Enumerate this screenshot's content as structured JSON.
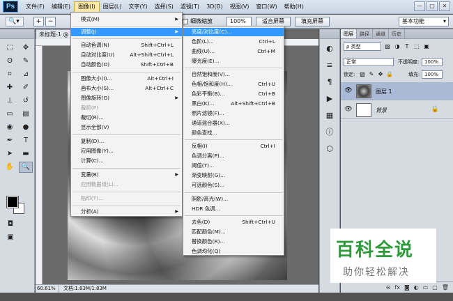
{
  "app": {
    "logo": "Ps"
  },
  "menubar": {
    "items": [
      "文件(F)",
      "编辑(E)",
      "图像(I)",
      "图层(L)",
      "文字(Y)",
      "选择(S)",
      "滤镜(T)",
      "3D(D)",
      "视图(V)",
      "窗口(W)",
      "帮助(H)"
    ],
    "active_index": 2,
    "window_controls": [
      "—",
      "□",
      "✕"
    ]
  },
  "options_bar": {
    "scrubby_zoom": "细微缩放",
    "zoom_value": "100%",
    "fit_screen": "适合屏幕",
    "fill_screen": "填充屏幕",
    "workspace": "基本功能"
  },
  "document": {
    "tab_title": "未标题-1 @",
    "zoom": "60.61%",
    "doc_info": "文档:1.83M/1.83M"
  },
  "image_menu": {
    "items": [
      {
        "label": "模式(M)",
        "shortcut": "",
        "submenu": true,
        "disabled": false
      },
      {
        "label": "调整(J)",
        "shortcut": "",
        "submenu": true,
        "disabled": false,
        "highlighted": true
      },
      {
        "label": "自动色调(N)",
        "shortcut": "Shift+Ctrl+L",
        "disabled": false
      },
      {
        "label": "自动对比度(U)",
        "shortcut": "Alt+Shift+Ctrl+L",
        "disabled": false
      },
      {
        "label": "自动颜色(O)",
        "shortcut": "Shift+Ctrl+B",
        "disabled": false
      },
      {
        "label": "图像大小(I)...",
        "shortcut": "Alt+Ctrl+I",
        "disabled": false
      },
      {
        "label": "画布大小(S)...",
        "shortcut": "Alt+Ctrl+C",
        "disabled": false
      },
      {
        "label": "图像旋转(G)",
        "shortcut": "",
        "submenu": true,
        "disabled": false
      },
      {
        "label": "裁剪(P)",
        "shortcut": "",
        "disabled": true
      },
      {
        "label": "裁切(R)...",
        "shortcut": "",
        "disabled": false
      },
      {
        "label": "显示全部(V)",
        "shortcut": "",
        "disabled": false
      },
      {
        "label": "复制(D)...",
        "shortcut": "",
        "disabled": false
      },
      {
        "label": "应用图像(Y)...",
        "shortcut": "",
        "disabled": false
      },
      {
        "label": "计算(C)...",
        "shortcut": "",
        "disabled": false
      },
      {
        "label": "变量(B)",
        "shortcut": "",
        "submenu": true,
        "disabled": false
      },
      {
        "label": "应用数据组(L)...",
        "shortcut": "",
        "disabled": true
      },
      {
        "label": "陷印(T)...",
        "shortcut": "",
        "disabled": true
      },
      {
        "label": "分析(A)",
        "shortcut": "",
        "submenu": true,
        "disabled": false
      }
    ]
  },
  "adjust_menu": {
    "items": [
      {
        "label": "亮度/对比度(C)...",
        "shortcut": "",
        "highlighted": true
      },
      {
        "label": "色阶(L)...",
        "shortcut": "Ctrl+L"
      },
      {
        "label": "曲线(U)...",
        "shortcut": "Ctrl+M"
      },
      {
        "label": "曝光度(E)...",
        "shortcut": ""
      },
      {
        "label": "自然饱和度(V)...",
        "shortcut": ""
      },
      {
        "label": "色相/饱和度(H)...",
        "shortcut": "Ctrl+U"
      },
      {
        "label": "色彩平衡(B)...",
        "shortcut": "Ctrl+B"
      },
      {
        "label": "黑白(K)...",
        "shortcut": "Alt+Shift+Ctrl+B"
      },
      {
        "label": "照片滤镜(F)...",
        "shortcut": ""
      },
      {
        "label": "通道混合器(X)...",
        "shortcut": ""
      },
      {
        "label": "颜色查找...",
        "shortcut": ""
      },
      {
        "label": "反相(I)",
        "shortcut": "Ctrl+I"
      },
      {
        "label": "色调分离(P)...",
        "shortcut": ""
      },
      {
        "label": "阈值(T)...",
        "shortcut": ""
      },
      {
        "label": "渐变映射(G)...",
        "shortcut": ""
      },
      {
        "label": "可选颜色(S)...",
        "shortcut": ""
      },
      {
        "label": "阴影/高光(W)...",
        "shortcut": ""
      },
      {
        "label": "HDR 色调...",
        "shortcut": ""
      },
      {
        "label": "去色(D)",
        "shortcut": "Shift+Ctrl+U"
      },
      {
        "label": "匹配颜色(M)...",
        "shortcut": ""
      },
      {
        "label": "替换颜色(R)...",
        "shortcut": ""
      },
      {
        "label": "色调均化(Q)",
        "shortcut": ""
      }
    ]
  },
  "layers_panel": {
    "tabs": [
      "图层",
      "路径",
      "通道",
      "历史"
    ],
    "kind": "类型",
    "blend_mode": "正常",
    "opacity_label": "不透明度:",
    "opacity": "100%",
    "lock_label": "锁定:",
    "fill_label": "填充:",
    "fill": "100%",
    "layers": [
      {
        "name": "图层 1",
        "selected": true
      },
      {
        "name": "背景",
        "selected": false
      }
    ]
  },
  "watermark": {
    "big": "百科全说",
    "small": "助你轻松解决"
  }
}
